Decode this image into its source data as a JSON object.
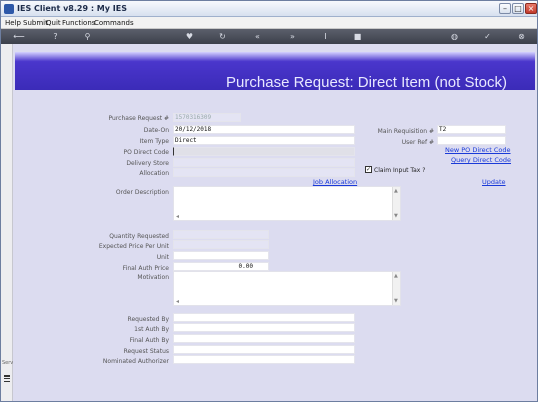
{
  "window": {
    "title": "IES Client v8.29 : My IES"
  },
  "menu": [
    "Help",
    "Submit",
    "Quit",
    "Functions",
    "Commands"
  ],
  "toolbar_icons": [
    "back-icon",
    "help-icon",
    "search-icon",
    "heart-icon",
    "refresh-icon",
    "rewind-icon",
    "fast-forward-icon",
    "text-cursor-icon",
    "stop-icon",
    "globe-icon",
    "check-icon",
    "close-icon"
  ],
  "page": {
    "title": "Purchase Request: Direct Item (not Stock)"
  },
  "form": {
    "purchase_request_no": {
      "label": "Purchase Request #",
      "value": "1570316309"
    },
    "date_on": {
      "label": "Date-On",
      "value": "20/12/2018"
    },
    "item_type": {
      "label": "Item Type",
      "value": "Direct"
    },
    "po_direct_code": {
      "label": "PO Direct Code",
      "value": ""
    },
    "delivery_store": {
      "label": "Delivery Store",
      "value": ""
    },
    "allocation": {
      "label": "Allocation",
      "value": ""
    },
    "main_requisition_no": {
      "label": "Main Requisition #",
      "value": "T2"
    },
    "user_ref_no": {
      "label": "User Ref #",
      "value": ""
    },
    "claim_input_tax": {
      "label": "Claim Input Tax ?",
      "checked": true
    },
    "order_description": {
      "label": "Order Description",
      "value": ""
    },
    "quantity_requested": {
      "label": "Quantity Requested",
      "value": ""
    },
    "expected_price_per_unit": {
      "label": "Expected Price Per Unit",
      "value": ""
    },
    "unit": {
      "label": "Unit",
      "value": ""
    },
    "final_auth_price": {
      "label": "Final Auth Price",
      "value": "0.00"
    },
    "motivation": {
      "label": "Motivation",
      "value": ""
    },
    "requested_by": {
      "label": "Requested By",
      "value": ""
    },
    "first_auth_by": {
      "label": "1st Auth By",
      "value": ""
    },
    "final_auth_by": {
      "label": "Final Auth By",
      "value": ""
    },
    "request_status": {
      "label": "Request Status",
      "value": ""
    },
    "nominated_authorizer": {
      "label": "Nominated Authorizer",
      "value": ""
    }
  },
  "links": {
    "new_po_direct_code": "New PO Direct Code",
    "query_direct_code": "Query Direct Code",
    "job_allocation": "Job Allocation",
    "update": "Update"
  },
  "sidebar": {
    "note": "Serv"
  }
}
